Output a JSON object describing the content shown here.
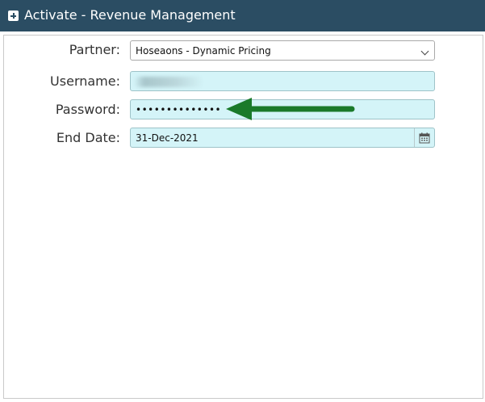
{
  "header": {
    "title": "Activate - Revenue Management",
    "icon": "plus-square-icon"
  },
  "form": {
    "partner": {
      "label": "Partner:",
      "selected": "Hoseaons - Dynamic Pricing"
    },
    "username": {
      "label": "Username:",
      "value": ""
    },
    "password": {
      "label": "Password:",
      "value": "••••••••••••••"
    },
    "end_date": {
      "label": "End Date:",
      "value": "31-Dec-2021"
    }
  },
  "colors": {
    "header_bg": "#2b4d63",
    "field_highlight": "#d4f4f8",
    "arrow": "#1a7a2a"
  }
}
